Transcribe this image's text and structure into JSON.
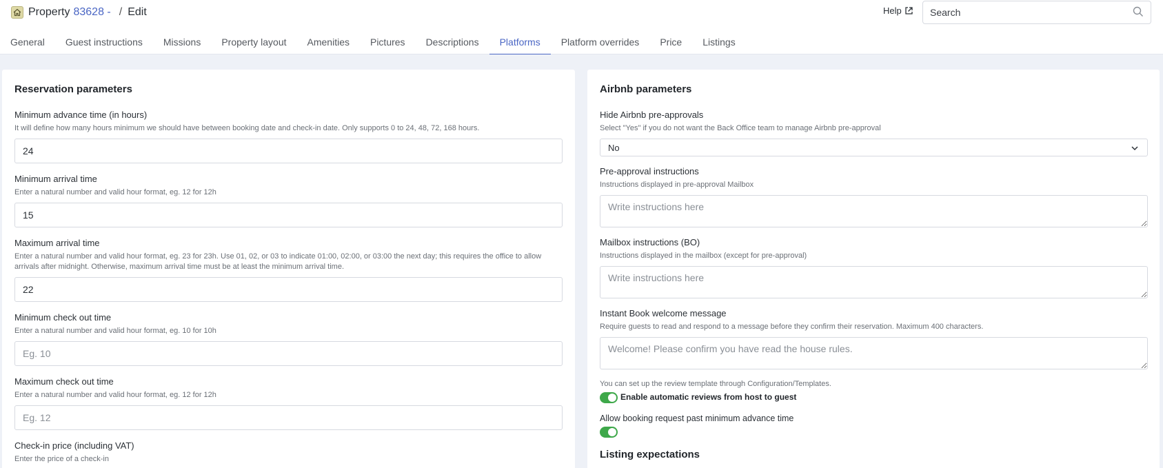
{
  "header": {
    "title_prefix": "Property",
    "property_id": "83628 -",
    "separator": "/",
    "page": "Edit",
    "help_label": "Help",
    "search_placeholder": "Search"
  },
  "tabs": [
    {
      "label": "General"
    },
    {
      "label": "Guest instructions"
    },
    {
      "label": "Missions"
    },
    {
      "label": "Property layout"
    },
    {
      "label": "Amenities"
    },
    {
      "label": "Pictures"
    },
    {
      "label": "Descriptions"
    },
    {
      "label": "Platforms",
      "active": true
    },
    {
      "label": "Platform overrides"
    },
    {
      "label": "Price"
    },
    {
      "label": "Listings"
    }
  ],
  "reservation": {
    "title": "Reservation parameters",
    "min_advance": {
      "label": "Minimum advance time (in hours)",
      "help": "It will define how many hours minimum we should have between booking date and check-in date. Only supports 0 to 24, 48, 72, 168 hours.",
      "value": "24"
    },
    "min_arrival": {
      "label": "Minimum arrival time",
      "help": "Enter a natural number and valid hour format, eg. 12 for 12h",
      "value": "15"
    },
    "max_arrival": {
      "label": "Maximum arrival time",
      "help": "Enter a natural number and valid hour format, eg. 23 for 23h. Use 01, 02, or 03 to indicate 01:00, 02:00, or 03:00 the next day; this requires the office to allow arrivals after midnight. Otherwise, maximum arrival time must be at least the minimum arrival time.",
      "value": "22"
    },
    "min_checkout": {
      "label": "Minimum check out time",
      "help": "Enter a natural number and valid hour format, eg. 10 for 10h",
      "placeholder": "Eg. 10"
    },
    "max_checkout": {
      "label": "Maximum check out time",
      "help": "Enter a natural number and valid hour format, eg. 12 for 12h",
      "placeholder": "Eg. 12"
    },
    "checkin_price": {
      "label": "Check-in price (including VAT)",
      "help": "Enter the price of a check-in"
    }
  },
  "airbnb": {
    "title": "Airbnb parameters",
    "hide_preapprovals": {
      "label": "Hide Airbnb pre-approvals",
      "help": "Select \"Yes\" if you do not want the Back Office team to manage Airbnb pre-approval",
      "value": "No"
    },
    "preapproval_instructions": {
      "label": "Pre-approval instructions",
      "help": "Instructions displayed in pre-approval Mailbox",
      "placeholder": "Write instructions here"
    },
    "mailbox_instructions": {
      "label": "Mailbox instructions (BO)",
      "help": "Instructions displayed in the mailbox (except for pre-approval)",
      "placeholder": "Write instructions here"
    },
    "instant_book": {
      "label": "Instant Book welcome message",
      "help": "Require guests to read and respond to a message before they confirm their reservation. Maximum 400 characters.",
      "placeholder": "Welcome! Please confirm you have read the house rules."
    },
    "review_note": "You can set up the review template through Configuration/Templates.",
    "auto_reviews_label": "Enable automatic reviews from host to guest",
    "allow_booking_label": "Allow booking request past minimum advance time",
    "listing_expectations": "Listing expectations"
  },
  "colors": {
    "accent": "#4a66c4",
    "toggle_on": "#3ea84a",
    "background": "#eef1f7"
  }
}
